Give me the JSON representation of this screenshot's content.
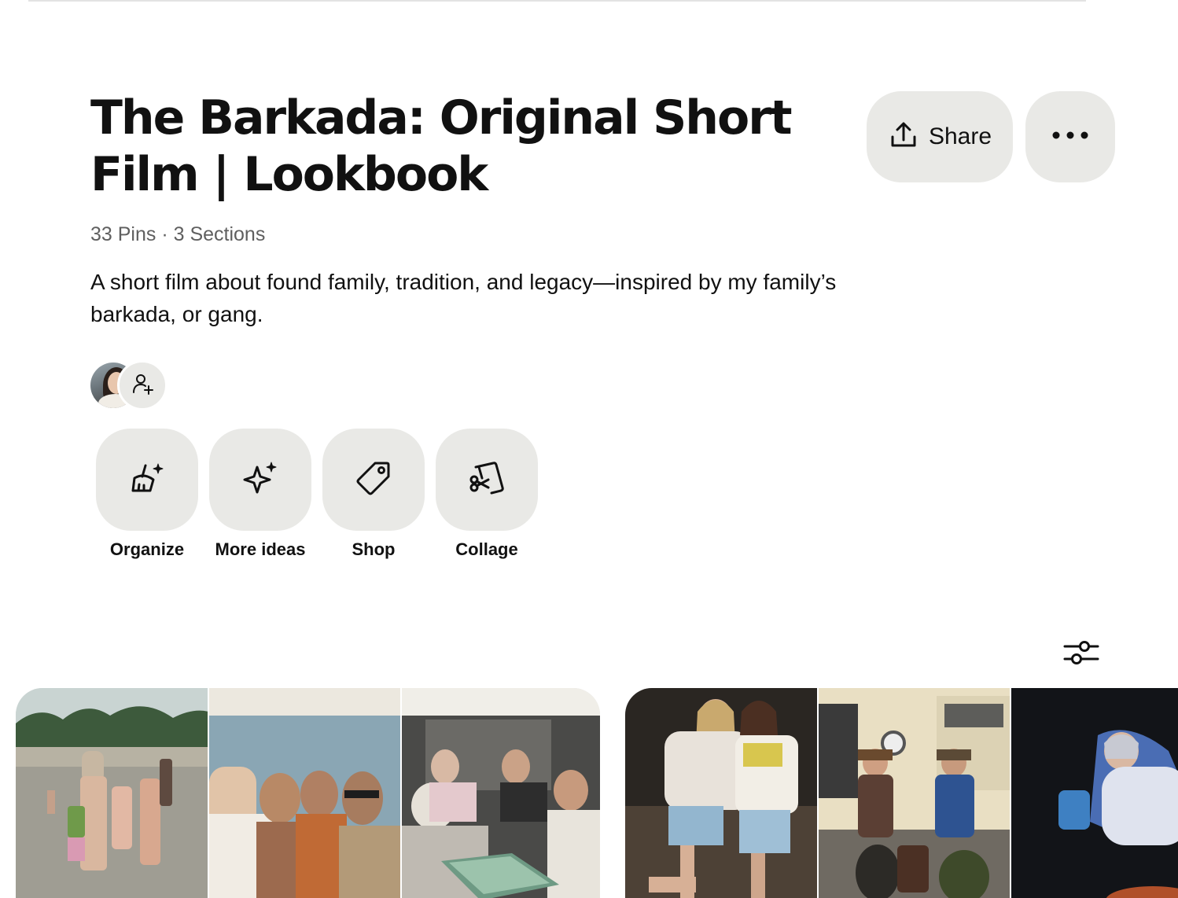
{
  "board": {
    "title": "The Barkada: Original Short Film | Lookbook",
    "meta": "33 Pins · 3 Sections",
    "description": "A short film about found family, tradition, and legacy—inspired by my family’s barkada, or gang."
  },
  "header_actions": {
    "share_label": "Share",
    "share_icon": "share-upload-icon",
    "more_icon": "ellipsis-icon"
  },
  "collaborators": {
    "owner_avatar": "avatar",
    "add_icon": "add-person-icon"
  },
  "tools": [
    {
      "label": "Organize",
      "icon": "broom-sparkle-icon"
    },
    {
      "label": "More ideas",
      "icon": "sparkle-icon"
    },
    {
      "label": "Shop",
      "icon": "price-tag-icon"
    },
    {
      "label": "Collage",
      "icon": "scissors-collage-icon"
    }
  ],
  "filter": {
    "icon": "sliders-icon"
  },
  "colors": {
    "button_bg": "#e9e9e6",
    "text": "#111111",
    "meta_text": "#5f5f5f"
  }
}
